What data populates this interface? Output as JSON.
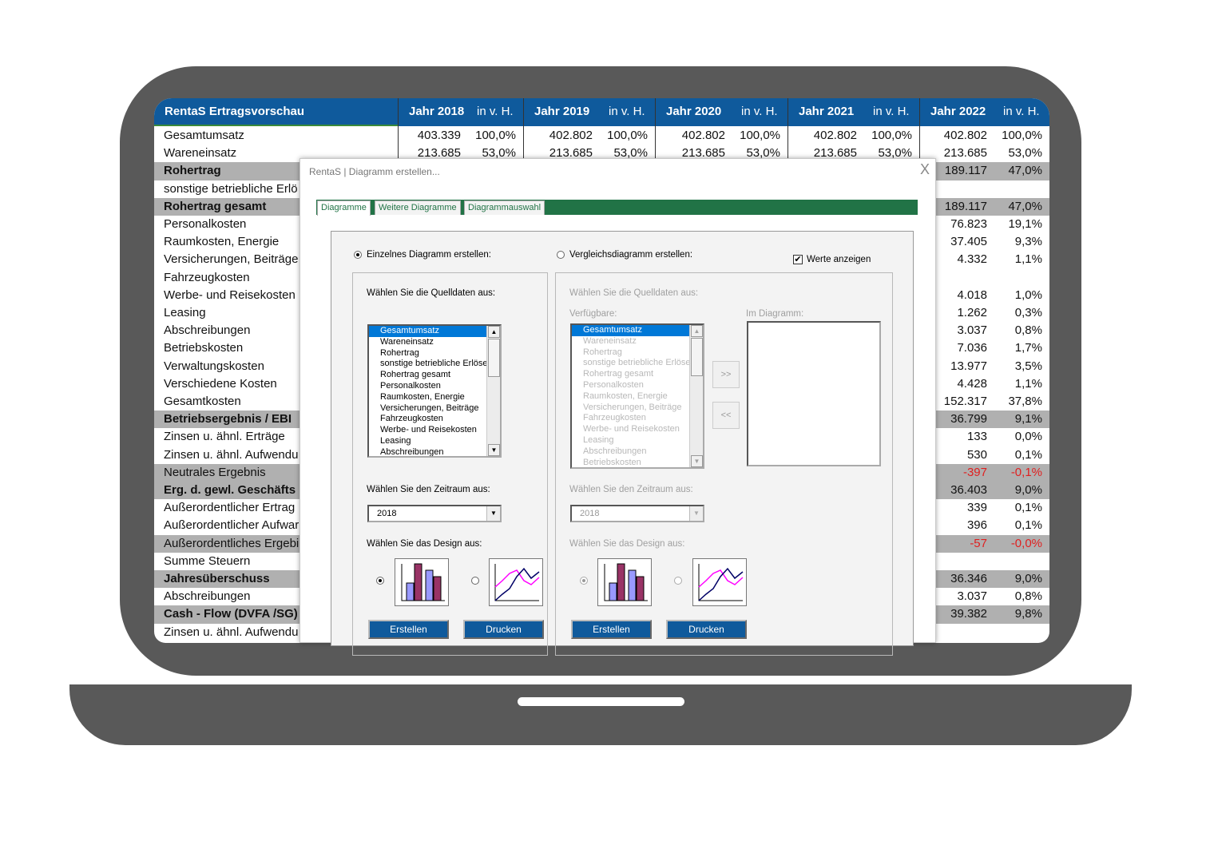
{
  "sheet": {
    "title": "RentaS Ertragsvorschau",
    "years": [
      {
        "label": "Jahr 2018",
        "pct": "in v. H."
      },
      {
        "label": "Jahr 2019",
        "pct": "in v. H."
      },
      {
        "label": "Jahr 2020",
        "pct": "in v. H."
      },
      {
        "label": "Jahr 2021",
        "pct": "in v. H."
      },
      {
        "label": "Jahr 2022",
        "pct": "in v. H."
      }
    ],
    "rows": [
      {
        "label": "Gesamtumsatz",
        "style": "normal",
        "values": [
          [
            "403.339",
            "100,0%"
          ],
          [
            "402.802",
            "100,0%"
          ],
          [
            "402.802",
            "100,0%"
          ],
          [
            "402.802",
            "100,0%"
          ],
          [
            "402.802",
            "100,0%"
          ]
        ]
      },
      {
        "label": "Wareneinsatz",
        "style": "normal",
        "values": [
          [
            "213.685",
            "53,0%"
          ],
          [
            "213.685",
            "53,0%"
          ],
          [
            "213.685",
            "53,0%"
          ],
          [
            "213.685",
            "53,0%"
          ],
          [
            "213.685",
            "53,0%"
          ]
        ]
      },
      {
        "label": "Rohertrag",
        "style": "gray-bold",
        "last": [
          "189.117",
          "47,0%"
        ]
      },
      {
        "label": "sonstige betriebliche Erlö",
        "style": "normal",
        "last": [
          "",
          ""
        ]
      },
      {
        "label": "Rohertrag gesamt",
        "style": "gray-bold",
        "last": [
          "189.117",
          "47,0%"
        ]
      },
      {
        "label": "Personalkosten",
        "style": "normal",
        "last": [
          "76.823",
          "19,1%"
        ]
      },
      {
        "label": "Raumkosten,  Energie",
        "style": "normal",
        "last": [
          "37.405",
          "9,3%"
        ]
      },
      {
        "label": "Versicherungen, Beiträge",
        "style": "normal",
        "last": [
          "4.332",
          "1,1%"
        ]
      },
      {
        "label": "Fahrzeugkosten",
        "style": "normal",
        "last": [
          "",
          ""
        ]
      },
      {
        "label": "Werbe- und Reisekosten",
        "style": "normal",
        "last": [
          "4.018",
          "1,0%"
        ]
      },
      {
        "label": "Leasing",
        "style": "normal",
        "last": [
          "1.262",
          "0,3%"
        ]
      },
      {
        "label": "Abschreibungen",
        "style": "normal",
        "last": [
          "3.037",
          "0,8%"
        ]
      },
      {
        "label": "Betriebskosten",
        "style": "normal",
        "last": [
          "7.036",
          "1,7%"
        ]
      },
      {
        "label": "Verwaltungskosten",
        "style": "normal",
        "last": [
          "13.977",
          "3,5%"
        ]
      },
      {
        "label": "Verschiedene Kosten",
        "style": "normal",
        "last": [
          "4.428",
          "1,1%"
        ]
      },
      {
        "label": "Gesamtkosten",
        "style": "normal",
        "last": [
          "152.317",
          "37,8%"
        ]
      },
      {
        "label": "Betriebsergebnis / EBI",
        "style": "gray-bold",
        "last": [
          "36.799",
          "9,1%"
        ]
      },
      {
        "label": "Zinsen u. ähnl. Erträge",
        "style": "normal",
        "last": [
          "133",
          "0,0%"
        ]
      },
      {
        "label": "Zinsen u. ähnl. Aufwendu",
        "style": "normal",
        "last": [
          "530",
          "0,1%"
        ]
      },
      {
        "label": "Neutrales Ergebnis",
        "style": "gray",
        "last": [
          "-397",
          "-0,1%"
        ],
        "negative": true
      },
      {
        "label": "Erg. d. gewl. Geschäfts",
        "style": "gray-bold",
        "last": [
          "36.403",
          "9,0%"
        ]
      },
      {
        "label": "Außerordentlicher Ertrag",
        "style": "normal",
        "last": [
          "339",
          "0,1%"
        ]
      },
      {
        "label": "Außerordentlicher Aufwar",
        "style": "normal",
        "last": [
          "396",
          "0,1%"
        ]
      },
      {
        "label": "Außerordentliches Ergebi",
        "style": "gray",
        "last": [
          "-57",
          "-0,0%"
        ],
        "negative": true
      },
      {
        "label": "Summe Steuern",
        "style": "normal",
        "last": [
          "",
          ""
        ]
      },
      {
        "label": "Jahresüberschuss",
        "style": "gray-bold",
        "last": [
          "36.346",
          "9,0%"
        ]
      },
      {
        "label": "Abschreibungen",
        "style": "normal",
        "last": [
          "3.037",
          "0,8%"
        ]
      },
      {
        "label": "Cash - Flow (DVFA /SG)",
        "style": "gray-bold",
        "last": [
          "39.382",
          "9,8%"
        ]
      },
      {
        "label": "Zinsen u. ähnl. Aufwendu",
        "style": "normal",
        "last": [
          "",
          ""
        ]
      }
    ]
  },
  "dialog": {
    "title": "RentaS | Diagramm erstellen...",
    "close": "X",
    "tabs": [
      {
        "label": "Diagramme",
        "active": true
      },
      {
        "label": "Weitere Diagramme"
      },
      {
        "label": "Diagrammauswahl"
      }
    ],
    "mode_single": "Einzelnes Diagramm erstellen:",
    "mode_compare": "Vergleichsdiagramm erstellen:",
    "show_values": "Werte anzeigen",
    "show_values_checked": true,
    "single": {
      "source_label": "Wählen Sie die Quelldaten aus:",
      "items": [
        "Gesamtumsatz",
        "Wareneinsatz",
        "Rohertrag",
        "sonstige betriebliche Erlöse",
        "Rohertrag gesamt",
        "Personalkosten",
        "Raumkosten,  Energie",
        "Versicherungen, Beiträge",
        "Fahrzeugkosten",
        "Werbe- und Reisekosten",
        "Leasing",
        "Abschreibungen"
      ],
      "selected": "Gesamtumsatz",
      "period_label": "Wählen Sie den Zeitraum aus:",
      "period": "2018",
      "design_label": "Wählen Sie das Design aus:",
      "create": "Erstellen",
      "print": "Drucken"
    },
    "compare": {
      "source_label": "Wählen Sie die Quelldaten aus:",
      "available_label": "Verfügbare:",
      "in_chart_label": "Im Diagramm:",
      "items": [
        "Gesamtumsatz",
        "Wareneinsatz",
        "Rohertrag",
        "sonstige betriebliche Erlöse",
        "Rohertrag gesamt",
        "Personalkosten",
        "Raumkosten,  Energie",
        "Versicherungen, Beiträge",
        "Fahrzeugkosten",
        "Werbe- und Reisekosten",
        "Leasing",
        "Abschreibungen",
        "Betriebskosten"
      ],
      "add": ">>",
      "remove": "<<",
      "period_label": "Wählen Sie den Zeitraum aus:",
      "period": "2018",
      "design_label": "Wählen Sie das Design aus:",
      "create": "Erstellen",
      "print": "Drucken"
    },
    "colors": {
      "header": "#0f5a9c",
      "tabbar": "#217346",
      "selection": "#0078d7",
      "negative": "#e02020"
    }
  }
}
